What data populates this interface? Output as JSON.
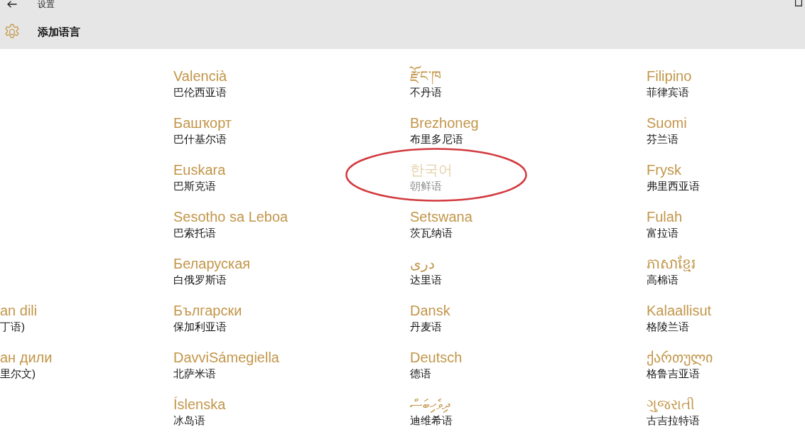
{
  "window": {
    "title": "设置"
  },
  "header": {
    "title": "添加语言"
  },
  "rows": [
    {
      "entries": [
        {
          "name": "Valencià",
          "description": "巴伦西亚语",
          "disabled": false,
          "circled": false
        },
        {
          "name": "རྫོང་ཁ",
          "description": "不丹语",
          "disabled": false,
          "circled": false
        },
        {
          "name": "Filipino",
          "description": "菲律宾语",
          "disabled": false,
          "circled": false
        }
      ]
    },
    {
      "entries": [
        {
          "name": "Башҡорт",
          "description": "巴什基尔语",
          "disabled": false,
          "circled": false
        },
        {
          "name": "Brezhoneg",
          "description": "布里多尼语",
          "disabled": false,
          "circled": false
        },
        {
          "name": "Suomi",
          "description": "芬兰语",
          "disabled": false,
          "circled": false
        }
      ]
    },
    {
      "entries": [
        {
          "name": "Euskara",
          "description": "巴斯克语",
          "disabled": false,
          "circled": false
        },
        {
          "name": "한국어",
          "description": "朝鲜语",
          "disabled": true,
          "circled": true
        },
        {
          "name": "Frysk",
          "description": "弗里西亚语",
          "disabled": false,
          "circled": false
        }
      ]
    },
    {
      "entries": [
        {
          "name": "Sesotho sa Leboa",
          "description": "巴索托语",
          "disabled": false,
          "circled": false
        },
        {
          "name": "Setswana",
          "description": "茨瓦纳语",
          "disabled": false,
          "circled": false
        },
        {
          "name": "Fulah",
          "description": "富拉语",
          "disabled": false,
          "circled": false
        }
      ]
    },
    {
      "entries": [
        {
          "name": "Беларуская",
          "description": "白俄罗斯语",
          "disabled": false,
          "circled": false
        },
        {
          "name": "دری",
          "description": "达里语",
          "disabled": false,
          "circled": false
        },
        {
          "name": "ភាសាខ្មែរ",
          "description": "高棉语",
          "disabled": false,
          "circled": false
        }
      ]
    },
    {
      "left_edge_entry": {
        "name": "an dili",
        "description": "丁语)",
        "disabled": false,
        "circled": false
      },
      "entries": [
        {
          "name": "Български",
          "description": "保加利亚语",
          "disabled": false,
          "circled": false
        },
        {
          "name": "Dansk",
          "description": "丹麦语",
          "disabled": false,
          "circled": false
        },
        {
          "name": "Kalaallisut",
          "description": "格陵兰语",
          "disabled": false,
          "circled": false
        }
      ]
    },
    {
      "left_edge_entry": {
        "name": "ан дили",
        "description": "里尔文)",
        "disabled": false,
        "circled": false
      },
      "entries": [
        {
          "name": "DavviSámegiella",
          "description": "北萨米语",
          "disabled": false,
          "circled": false
        },
        {
          "name": "Deutsch",
          "description": "德语",
          "disabled": false,
          "circled": false
        },
        {
          "name": "ქართული",
          "description": "格鲁吉亚语",
          "disabled": false,
          "circled": false
        }
      ]
    },
    {
      "entries": [
        {
          "name": "Íslenska",
          "description": "冰岛语",
          "disabled": false,
          "circled": false
        },
        {
          "name": "ދިވެހިބަސް",
          "description": "迪维希语",
          "disabled": false,
          "circled": false
        },
        {
          "name": "ગુજરાતી",
          "description": "古吉拉特语",
          "disabled": false,
          "circled": false
        }
      ]
    }
  ]
}
